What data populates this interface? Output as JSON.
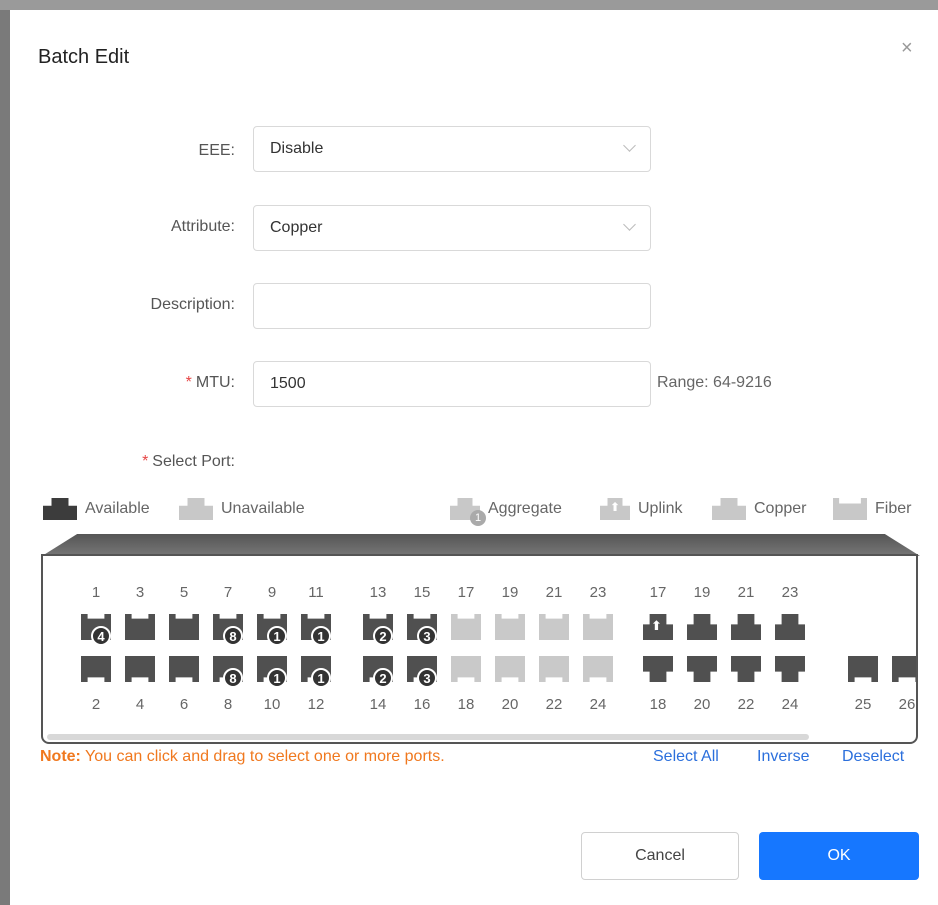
{
  "dialog": {
    "title": "Batch Edit",
    "close": "×"
  },
  "form": {
    "eee": {
      "label": "EEE:",
      "value": "Disable"
    },
    "attribute": {
      "label": "Attribute:",
      "value": "Copper"
    },
    "description": {
      "label": "Description:",
      "value": ""
    },
    "mtu": {
      "required": "*",
      "label": "MTU:",
      "value": "1500",
      "hint": "Range: 64-9216"
    },
    "select_port": {
      "required": "*",
      "label": "Select Port:"
    }
  },
  "legend": {
    "available": "Available",
    "unavailable": "Unavailable",
    "aggregate": "Aggregate",
    "aggregate_badge": "1",
    "uplink": "Uplink",
    "copper": "Copper",
    "fiber": "Fiber"
  },
  "ports": {
    "group1_top": [
      {
        "num": "1",
        "state": "avail",
        "badge": "4"
      },
      {
        "num": "3",
        "state": "avail",
        "badge": ""
      },
      {
        "num": "5",
        "state": "avail",
        "badge": ""
      },
      {
        "num": "7",
        "state": "avail",
        "badge": "8"
      },
      {
        "num": "9",
        "state": "avail",
        "badge": "1"
      },
      {
        "num": "11",
        "state": "avail",
        "badge": "1"
      }
    ],
    "group1_bottom": [
      {
        "num": "2",
        "state": "avail",
        "badge": ""
      },
      {
        "num": "4",
        "state": "avail",
        "badge": ""
      },
      {
        "num": "6",
        "state": "avail",
        "badge": ""
      },
      {
        "num": "8",
        "state": "avail",
        "badge": "8"
      },
      {
        "num": "10",
        "state": "avail",
        "badge": "1"
      },
      {
        "num": "12",
        "state": "avail",
        "badge": "1"
      }
    ],
    "group2_top": [
      {
        "num": "13",
        "state": "avail",
        "badge": "2"
      },
      {
        "num": "15",
        "state": "avail",
        "badge": "3"
      },
      {
        "num": "17",
        "state": "unavail",
        "badge": ""
      },
      {
        "num": "19",
        "state": "unavail",
        "badge": ""
      },
      {
        "num": "21",
        "state": "unavail",
        "badge": ""
      },
      {
        "num": "23",
        "state": "unavail",
        "badge": ""
      }
    ],
    "group2_bottom": [
      {
        "num": "14",
        "state": "avail",
        "badge": "2"
      },
      {
        "num": "16",
        "state": "avail",
        "badge": "3"
      },
      {
        "num": "18",
        "state": "unavail",
        "badge": ""
      },
      {
        "num": "20",
        "state": "unavail",
        "badge": ""
      },
      {
        "num": "22",
        "state": "unavail",
        "badge": ""
      },
      {
        "num": "24",
        "state": "unavail",
        "badge": ""
      }
    ],
    "copper_top": [
      {
        "num": "17",
        "uplink": true
      },
      {
        "num": "19",
        "uplink": false
      },
      {
        "num": "21",
        "uplink": false
      },
      {
        "num": "23",
        "uplink": false
      }
    ],
    "copper_bottom": [
      {
        "num": "18"
      },
      {
        "num": "20"
      },
      {
        "num": "22"
      },
      {
        "num": "24"
      }
    ],
    "fiber": [
      {
        "num": "25"
      },
      {
        "num": "26"
      }
    ]
  },
  "note": {
    "prefix": "Note:",
    "text": " You can click and drag to select one or more ports."
  },
  "actions": {
    "select_all": "Select All",
    "inverse": "Inverse",
    "deselect": "Deselect",
    "cancel": "Cancel",
    "ok": "OK"
  },
  "colors": {
    "primary": "#1677ff",
    "note": "#f0781e",
    "available_port": "#505050",
    "unavailable_port": "#c9c9c9"
  }
}
